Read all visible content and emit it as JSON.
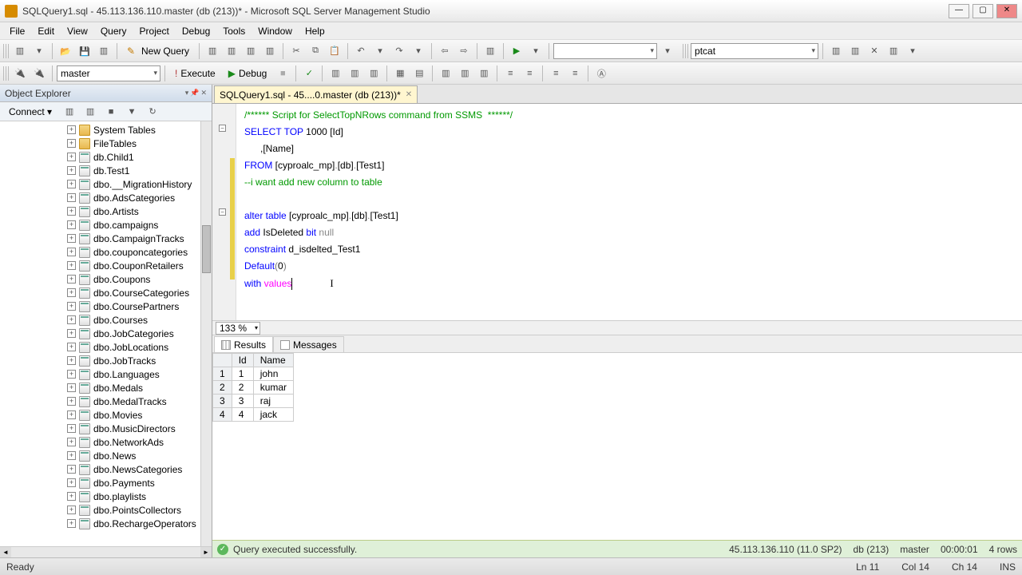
{
  "title": "SQLQuery1.sql - 45.113.136.110.master (db (213))* - Microsoft SQL Server Management Studio",
  "menu": [
    "File",
    "Edit",
    "View",
    "Query",
    "Project",
    "Debug",
    "Tools",
    "Window",
    "Help"
  ],
  "toolbar": {
    "new_query": "New Query",
    "db_combo": "master",
    "execute": "Execute",
    "debug": "Debug",
    "user_combo": "ptcat"
  },
  "object_explorer": {
    "title": "Object Explorer",
    "connect": "Connect ▾",
    "items": [
      {
        "type": "folder",
        "label": "System Tables"
      },
      {
        "type": "folder",
        "label": "FileTables"
      },
      {
        "type": "table",
        "label": "db.Child1"
      },
      {
        "type": "table",
        "label": "db.Test1"
      },
      {
        "type": "table",
        "label": "dbo.__MigrationHistory"
      },
      {
        "type": "table",
        "label": "dbo.AdsCategories"
      },
      {
        "type": "table",
        "label": "dbo.Artists"
      },
      {
        "type": "table",
        "label": "dbo.campaigns"
      },
      {
        "type": "table",
        "label": "dbo.CampaignTracks"
      },
      {
        "type": "table",
        "label": "dbo.couponcategories"
      },
      {
        "type": "table",
        "label": "dbo.CouponRetailers"
      },
      {
        "type": "table",
        "label": "dbo.Coupons"
      },
      {
        "type": "table",
        "label": "dbo.CourseCategories"
      },
      {
        "type": "table",
        "label": "dbo.CoursePartners"
      },
      {
        "type": "table",
        "label": "dbo.Courses"
      },
      {
        "type": "table",
        "label": "dbo.JobCategories"
      },
      {
        "type": "table",
        "label": "dbo.JobLocations"
      },
      {
        "type": "table",
        "label": "dbo.JobTracks"
      },
      {
        "type": "table",
        "label": "dbo.Languages"
      },
      {
        "type": "table",
        "label": "dbo.Medals"
      },
      {
        "type": "table",
        "label": "dbo.MedalTracks"
      },
      {
        "type": "table",
        "label": "dbo.Movies"
      },
      {
        "type": "table",
        "label": "dbo.MusicDirectors"
      },
      {
        "type": "table",
        "label": "dbo.NetworkAds"
      },
      {
        "type": "table",
        "label": "dbo.News"
      },
      {
        "type": "table",
        "label": "dbo.NewsCategories"
      },
      {
        "type": "table",
        "label": "dbo.Payments"
      },
      {
        "type": "table",
        "label": "dbo.playlists"
      },
      {
        "type": "table",
        "label": "dbo.PointsCollectors"
      },
      {
        "type": "table",
        "label": "dbo.RechargeOperators"
      }
    ]
  },
  "tab": {
    "label": "SQLQuery1.sql - 45....0.master (db (213))*"
  },
  "code": {
    "l1a": "/****** Script for SelectTopNRows command from SSMS  ******/",
    "l2a": "SELECT",
    "l2b": " TOP",
    "l2c": " 1000 [Id]",
    "l3": "      ,[Name]",
    "l4a": "FROM",
    "l4b": " [cyproalc_mp]",
    "l4c": ".",
    "l4d": "[db]",
    "l4e": ".",
    "l4f": "[Test1]",
    "l5": "--i want add new column to table",
    "l7a": "alter",
    "l7b": " table",
    "l7c": " [cyproalc_mp]",
    "l7d": ".",
    "l7e": "[db]",
    "l7f": ".",
    "l7g": "[Test1]",
    "l8a": "add",
    "l8b": " IsDeleted ",
    "l8c": "bit",
    "l8d": " null",
    "l9a": "constraint",
    "l9b": " d_isdelted_Test1",
    "l10a": "Default",
    "l10b": "(",
    "l10c": "0",
    "l10d": ")",
    "l11a": "with",
    "l11b": " values"
  },
  "zoom": "133 %",
  "results": {
    "tabs": {
      "results": "Results",
      "messages": "Messages"
    },
    "columns": [
      "",
      "Id",
      "Name"
    ],
    "rows": [
      {
        "n": "1",
        "id": "1",
        "name": "john"
      },
      {
        "n": "2",
        "id": "2",
        "name": "kumar"
      },
      {
        "n": "3",
        "id": "3",
        "name": "raj"
      },
      {
        "n": "4",
        "id": "4",
        "name": "jack"
      }
    ]
  },
  "query_status": {
    "msg": "Query executed successfully.",
    "server": "45.113.136.110 (11.0 SP2)",
    "db": "db (213)",
    "database": "master",
    "time": "00:00:01",
    "rows": "4 rows"
  },
  "statusbar": {
    "left": "Ready",
    "ln": "Ln 11",
    "col": "Col 14",
    "ch": "Ch 14",
    "ins": "INS"
  }
}
